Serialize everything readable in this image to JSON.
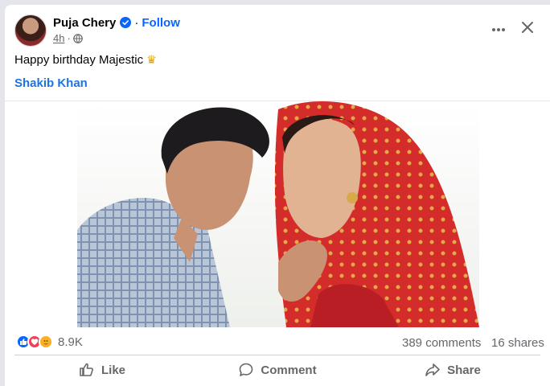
{
  "post": {
    "author": "Puja Chery",
    "follow_label": "Follow",
    "separator": "·",
    "time": "4h",
    "caption": "Happy birthday Majestic",
    "caption_emoji": "♛",
    "mention": "Shakib Khan"
  },
  "stats": {
    "reactions_count": "8.9K",
    "comments": "389 comments",
    "shares": "16 shares"
  },
  "actions": {
    "like": "Like",
    "comment": "Comment",
    "share": "Share"
  },
  "icons": {
    "verified": "verified-badge-icon",
    "globe": "globe-icon",
    "more": "more-dots-icon",
    "close": "close-icon",
    "like": "like-thumb-icon",
    "comment": "comment-bubble-icon",
    "share": "share-arrow-icon"
  },
  "colors": {
    "accent": "#0866ff",
    "mention": "#1b74e4",
    "like_reaction": "#0866ff",
    "love_reaction": "#f33e58",
    "care_reaction": "#f7b125"
  }
}
